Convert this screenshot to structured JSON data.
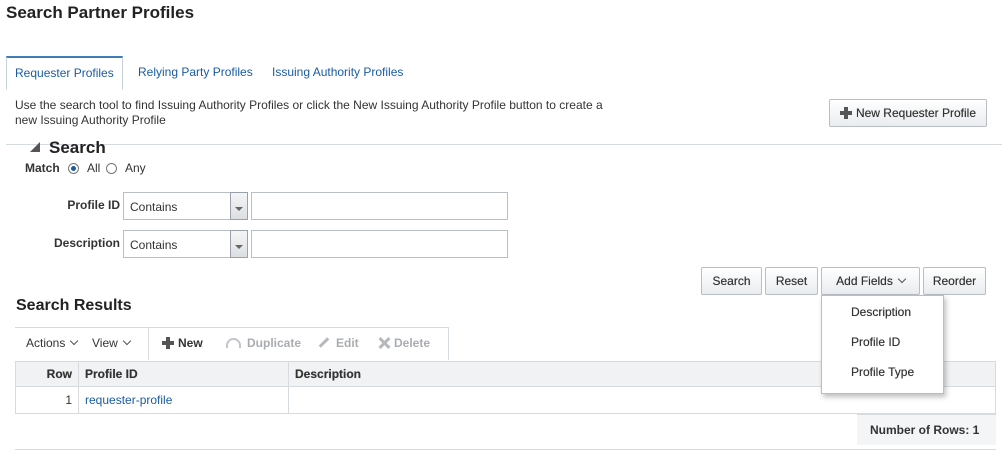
{
  "page": {
    "title": "Search Partner Profiles"
  },
  "tabs": [
    {
      "label": "Requester Profiles",
      "active": true
    },
    {
      "label": "Relying Party Profiles",
      "active": false
    },
    {
      "label": "Issuing Authority Profiles",
      "active": false
    }
  ],
  "help_text": "Use the search tool to find Issuing Authority Profiles or click the New Issuing Authority Profile button to create a new Issuing Authority Profile",
  "new_button_label": "New Requester Profile",
  "search": {
    "title": "Search",
    "match_label": "Match",
    "match_all": "All",
    "match_any": "Any",
    "fields": [
      {
        "label": "Profile ID",
        "operator": "Contains",
        "value": ""
      },
      {
        "label": "Description",
        "operator": "Contains",
        "value": ""
      }
    ],
    "buttons": {
      "search": "Search",
      "reset": "Reset",
      "add_fields": "Add Fields",
      "reorder": "Reorder"
    },
    "add_fields_menu": [
      "Description",
      "Profile ID",
      "Profile Type"
    ]
  },
  "results": {
    "title": "Search Results",
    "toolbar": {
      "actions": "Actions",
      "view": "View",
      "new": "New",
      "duplicate": "Duplicate",
      "edit": "Edit",
      "delete": "Delete"
    },
    "columns": [
      "Row",
      "Profile ID",
      "Description"
    ],
    "rows": [
      {
        "row": "1",
        "profile_id": "requester-profile",
        "description": ""
      }
    ],
    "row_count_label": "Number of Rows: 1"
  },
  "colors": {
    "link": "#1b5ca3",
    "active_tab_border": "#3f7cb8"
  }
}
